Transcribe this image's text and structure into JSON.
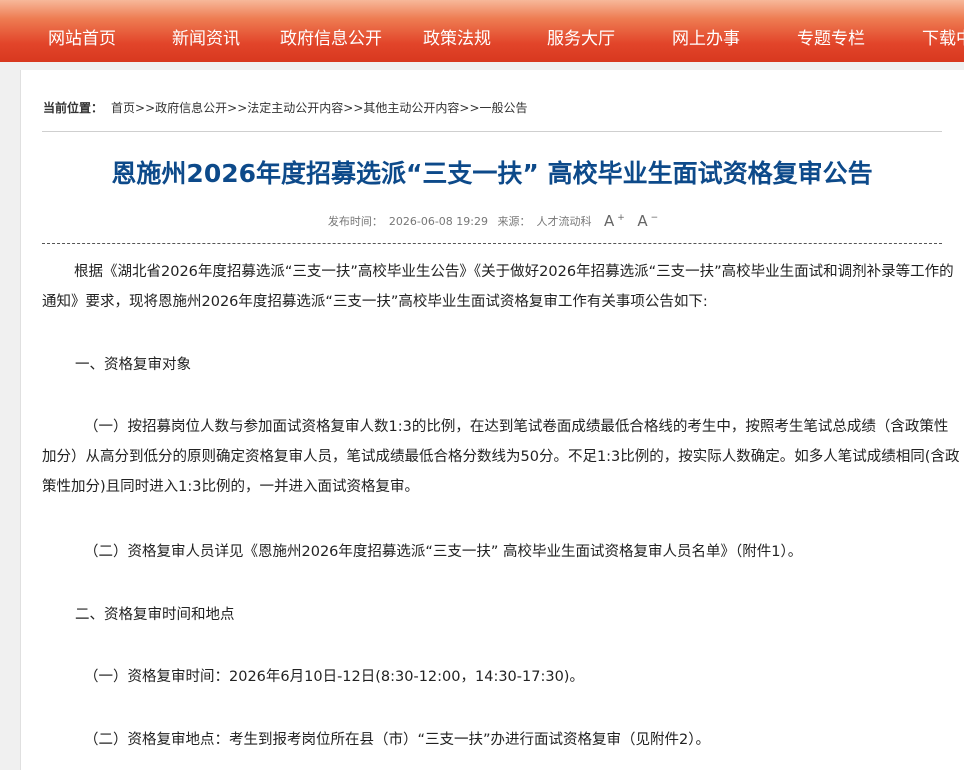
{
  "nav": {
    "items": [
      "网站首页",
      "新闻资讯",
      "政府信息公开",
      "政策法规",
      "服务大厅",
      "网上办事",
      "专题专栏",
      "下载中心"
    ]
  },
  "breadcrumb": {
    "label": "当前位置：",
    "items": [
      "首页",
      "政府信息公开",
      "法定主动公开内容",
      "其他主动公开内容",
      "一般公告"
    ],
    "sep": ">>"
  },
  "article": {
    "title": "恩施州2026年度招募选派“三支一扶” 高校毕业生面试资格复审公告",
    "publish_label": "发布时间：",
    "publish_time": "2026-06-08 19:29",
    "source_label": "来源：",
    "source": "人才流动科",
    "font_increase": "A",
    "font_decrease": "A",
    "paragraphs": [
      "根据《湖北省2026年度招募选派“三支一扶”高校毕业生公告》《关于做好2026年招募选派“三支一扶”高校毕业生面试和调剂补录等工作的通知》要求，现将恩施州2026年度招募选派“三支一扶”高校毕业生面试资格复审工作有关事项公告如下:",
      "一、资格复审对象",
      "（一）按招募岗位人数与参加面试资格复审人数1:3的比例，在达到笔试卷面成绩最低合格线的考生中，按照考生笔试总成绩（含政策性加分）从高分到低分的原则确定资格复审人员，笔试成绩最低合格分数线为50分。不足1:3比例的，按实际人数确定。如多人笔试成绩相同(含政策性加分)且同时进入1:3比例的，一并进入面试资格复审。",
      "（二）资格复审人员详见《恩施州2026年度招募选派“三支一扶” 高校毕业生面试资格复审人员名单》（附件1）。",
      "二、资格复审时间和地点",
      "（一）资格复审时间：2026年6月10日-12日(8:30-12:00，14:30-17:30)。",
      "（二）资格复审地点：考生到报考岗位所在县（市）“三支一扶”办进行面试资格复审（见附件2）。"
    ]
  }
}
